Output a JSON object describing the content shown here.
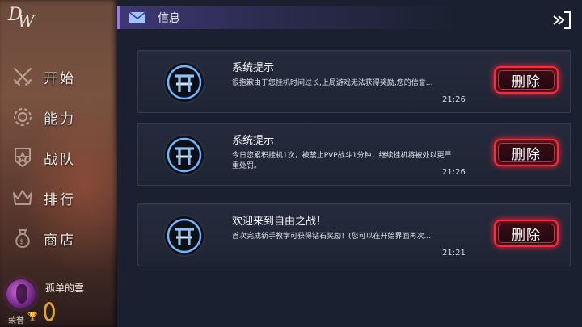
{
  "logo": {
    "line1": "D",
    "line2": "W"
  },
  "sidebar": {
    "items": [
      {
        "label": "开始",
        "icon": "crossed-swords-icon"
      },
      {
        "label": "能力",
        "icon": "gear-icon"
      },
      {
        "label": "战队",
        "icon": "team-shield-icon"
      },
      {
        "label": "排行",
        "icon": "crown-icon"
      },
      {
        "label": "商店",
        "icon": "money-bag-icon"
      }
    ]
  },
  "profile": {
    "username": "孤单的雲",
    "honor_label": "荣誉",
    "trophy": "🏆"
  },
  "header": {
    "title": "信息",
    "icon": "mail-icon"
  },
  "messages": [
    {
      "title": "系统提示",
      "body": "很抱歉由于您挂机时间过长,上局游戏无法获得奖励,您的信誉...",
      "time": "21:26",
      "delete_label": "删除"
    },
    {
      "title": "系统提示",
      "body": "今日您累积挂机1次，被禁止PVP战斗1分钟，继续挂机将被处以更严重处罚。",
      "time": "21:26",
      "delete_label": "删除"
    },
    {
      "title": "欢迎来到自由之战！",
      "body": "首次完成新手教学可获得钻石奖励！(您可以在开始界面再次...",
      "time": "21:21",
      "delete_label": "删除"
    }
  ],
  "colors": {
    "accent_red": "#ff2a3a",
    "header_purple": "#8f7cf0",
    "emblem_blue": "#6fb6ff"
  }
}
